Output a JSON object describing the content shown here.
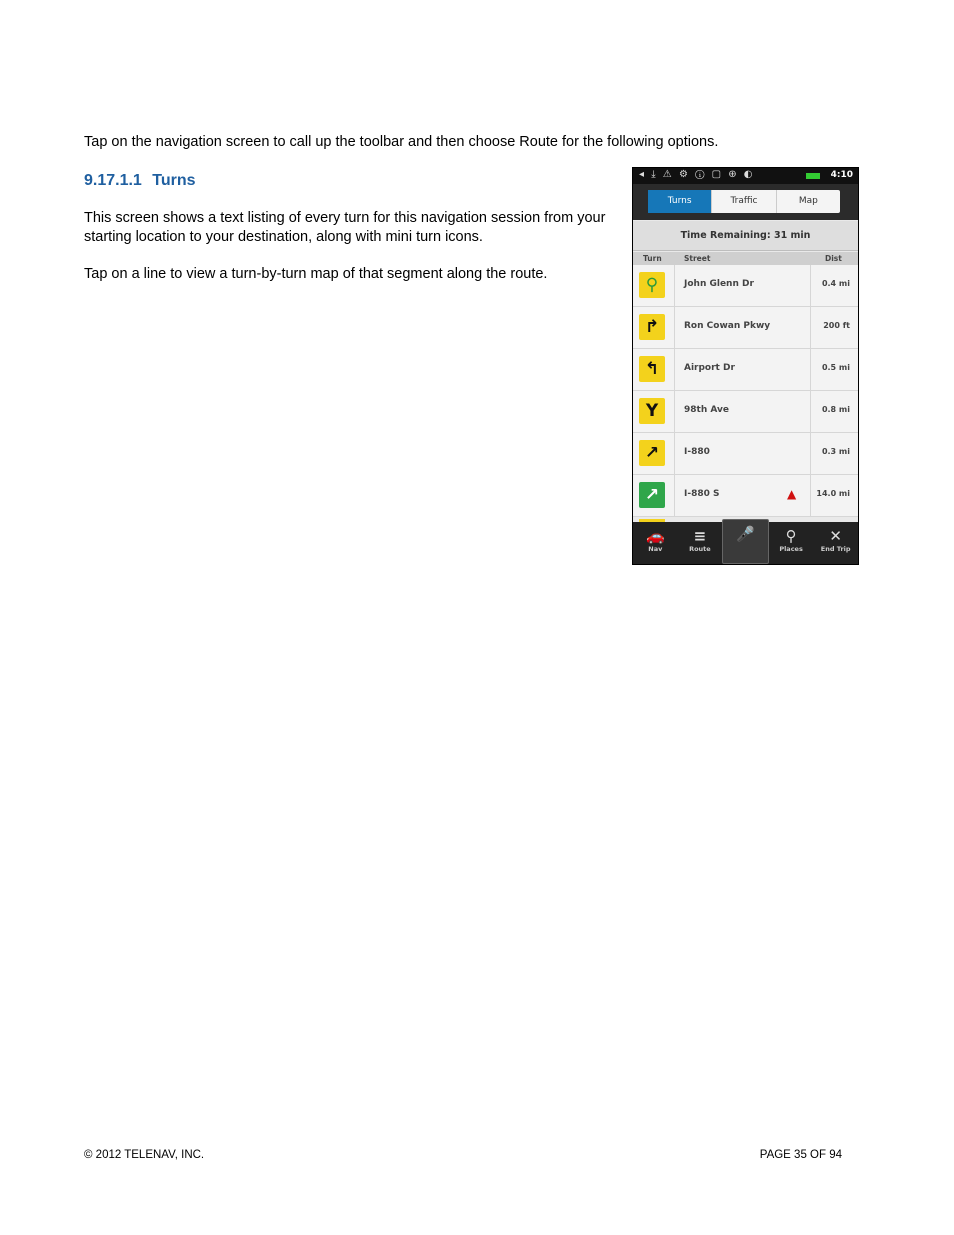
{
  "intro": "Tap on the navigation screen to call up the toolbar and then choose Route for the following options.",
  "section": {
    "number": "9.17.1.1",
    "title": "Turns"
  },
  "paragraphs": [
    "This screen shows a text listing of every turn for this navigation session from your starting location to your destination, along with mini turn icons.",
    "Tap on a line to view a turn-by-turn map of that segment along the route."
  ],
  "phone": {
    "status_time": "4:10",
    "tabs": [
      "Turns",
      "Traffic",
      "Map"
    ],
    "active_tab": "Turns",
    "time_remaining": "Time Remaining: 31 min",
    "columns": [
      "Turn",
      "Street",
      "Dist"
    ],
    "rows": [
      {
        "icon": "pin-icon",
        "glyph": "⚲",
        "street": "John Glenn Dr",
        "dist": "0.4 mi",
        "color": "#f3d21c"
      },
      {
        "icon": "turn-right-icon",
        "glyph": "↱",
        "street": "Ron Cowan Pkwy",
        "dist": "200 ft",
        "color": "#f3d21c"
      },
      {
        "icon": "turn-left-icon",
        "glyph": "↰",
        "street": "Airport Dr",
        "dist": "0.5 mi",
        "color": "#f3d21c"
      },
      {
        "icon": "fork-icon",
        "glyph": "Y",
        "street": "98th Ave",
        "dist": "0.8 mi",
        "color": "#f3d21c"
      },
      {
        "icon": "bear-right-icon",
        "glyph": "↗",
        "street": "I-880",
        "dist": "0.3 mi",
        "color": "#f3d21c"
      },
      {
        "icon": "highway-exit-icon",
        "glyph": "↗",
        "street": "I-880 S",
        "dist": "14.0 mi",
        "color": "#2fa64a"
      }
    ],
    "nav_items": [
      {
        "icon": "car-icon",
        "glyph": "🚗",
        "label": "Nav"
      },
      {
        "icon": "list-icon",
        "glyph": "≡",
        "label": "Route"
      },
      {
        "icon": "microphone-icon",
        "glyph": "🎤",
        "label": ""
      },
      {
        "icon": "places-pin-icon",
        "glyph": "⚲",
        "label": "Places"
      },
      {
        "icon": "close-icon",
        "glyph": "✕",
        "label": "End Trip"
      }
    ]
  },
  "footer": {
    "copyright": "© 2012 TELENAV, INC.",
    "page": "PAGE 35 OF 94"
  }
}
